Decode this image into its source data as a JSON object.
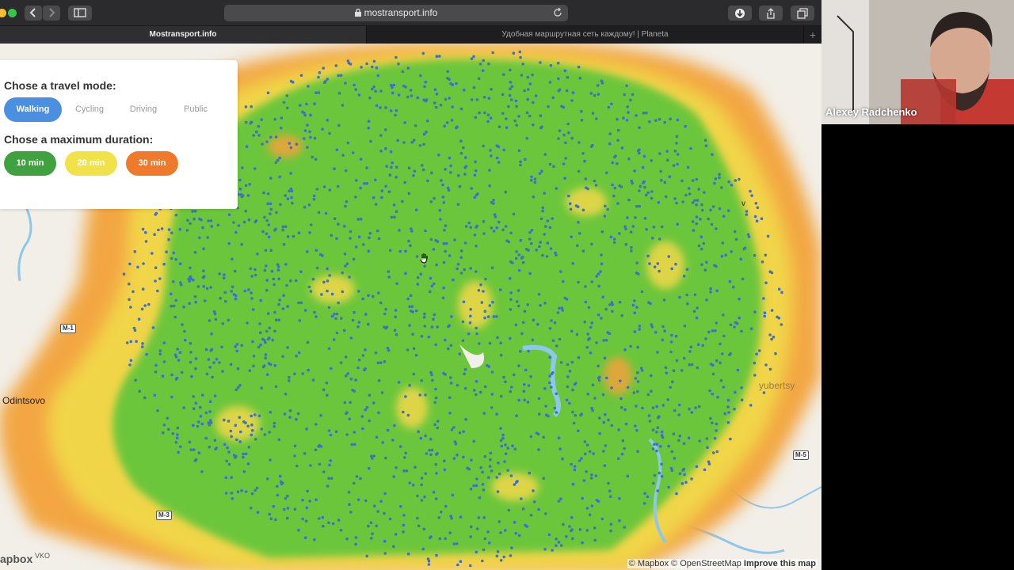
{
  "browser": {
    "url": "mostransport.info",
    "tabs": [
      {
        "label": "Mostransport.info",
        "active": true
      },
      {
        "label": "Удобная маршрутная сеть каждому! | Planeta",
        "active": false
      }
    ],
    "icons": [
      "back-icon",
      "forward-icon",
      "sidebar-icon",
      "lock-icon",
      "reload-icon",
      "download-icon",
      "share-icon",
      "tabs-icon",
      "plus-icon"
    ]
  },
  "panel": {
    "mode_title": "Chose a travel mode:",
    "modes": [
      "Walking",
      "Cycling",
      "Driving",
      "Public"
    ],
    "selected_mode": "Walking",
    "duration_title": "Chose a maximum duration:",
    "durations": [
      {
        "label": "10 min",
        "color": "#3fa23f"
      },
      {
        "label": "20 min",
        "color": "#f2e24a"
      },
      {
        "label": "30 min",
        "color": "#ef7a2c"
      }
    ]
  },
  "map": {
    "labels": {
      "odintsovo": "Odintsovo",
      "lyubertsy": "yubertsy",
      "v": "v"
    },
    "roads": {
      "m1": "M-1",
      "m5": "M-5",
      "m3": "M-3"
    },
    "vko": "VKO",
    "logo": "apbox",
    "attribution": {
      "mapbox": "© Mapbox",
      "osm": "© OpenStreetMap",
      "improve": "Improve this map"
    }
  },
  "webcam": {
    "name": "Alexey Radchenko"
  },
  "colors": {
    "walk_green": "#6cc63a",
    "dot_blue": "#3f6fc9",
    "accent_blue": "#4a8fe0"
  }
}
